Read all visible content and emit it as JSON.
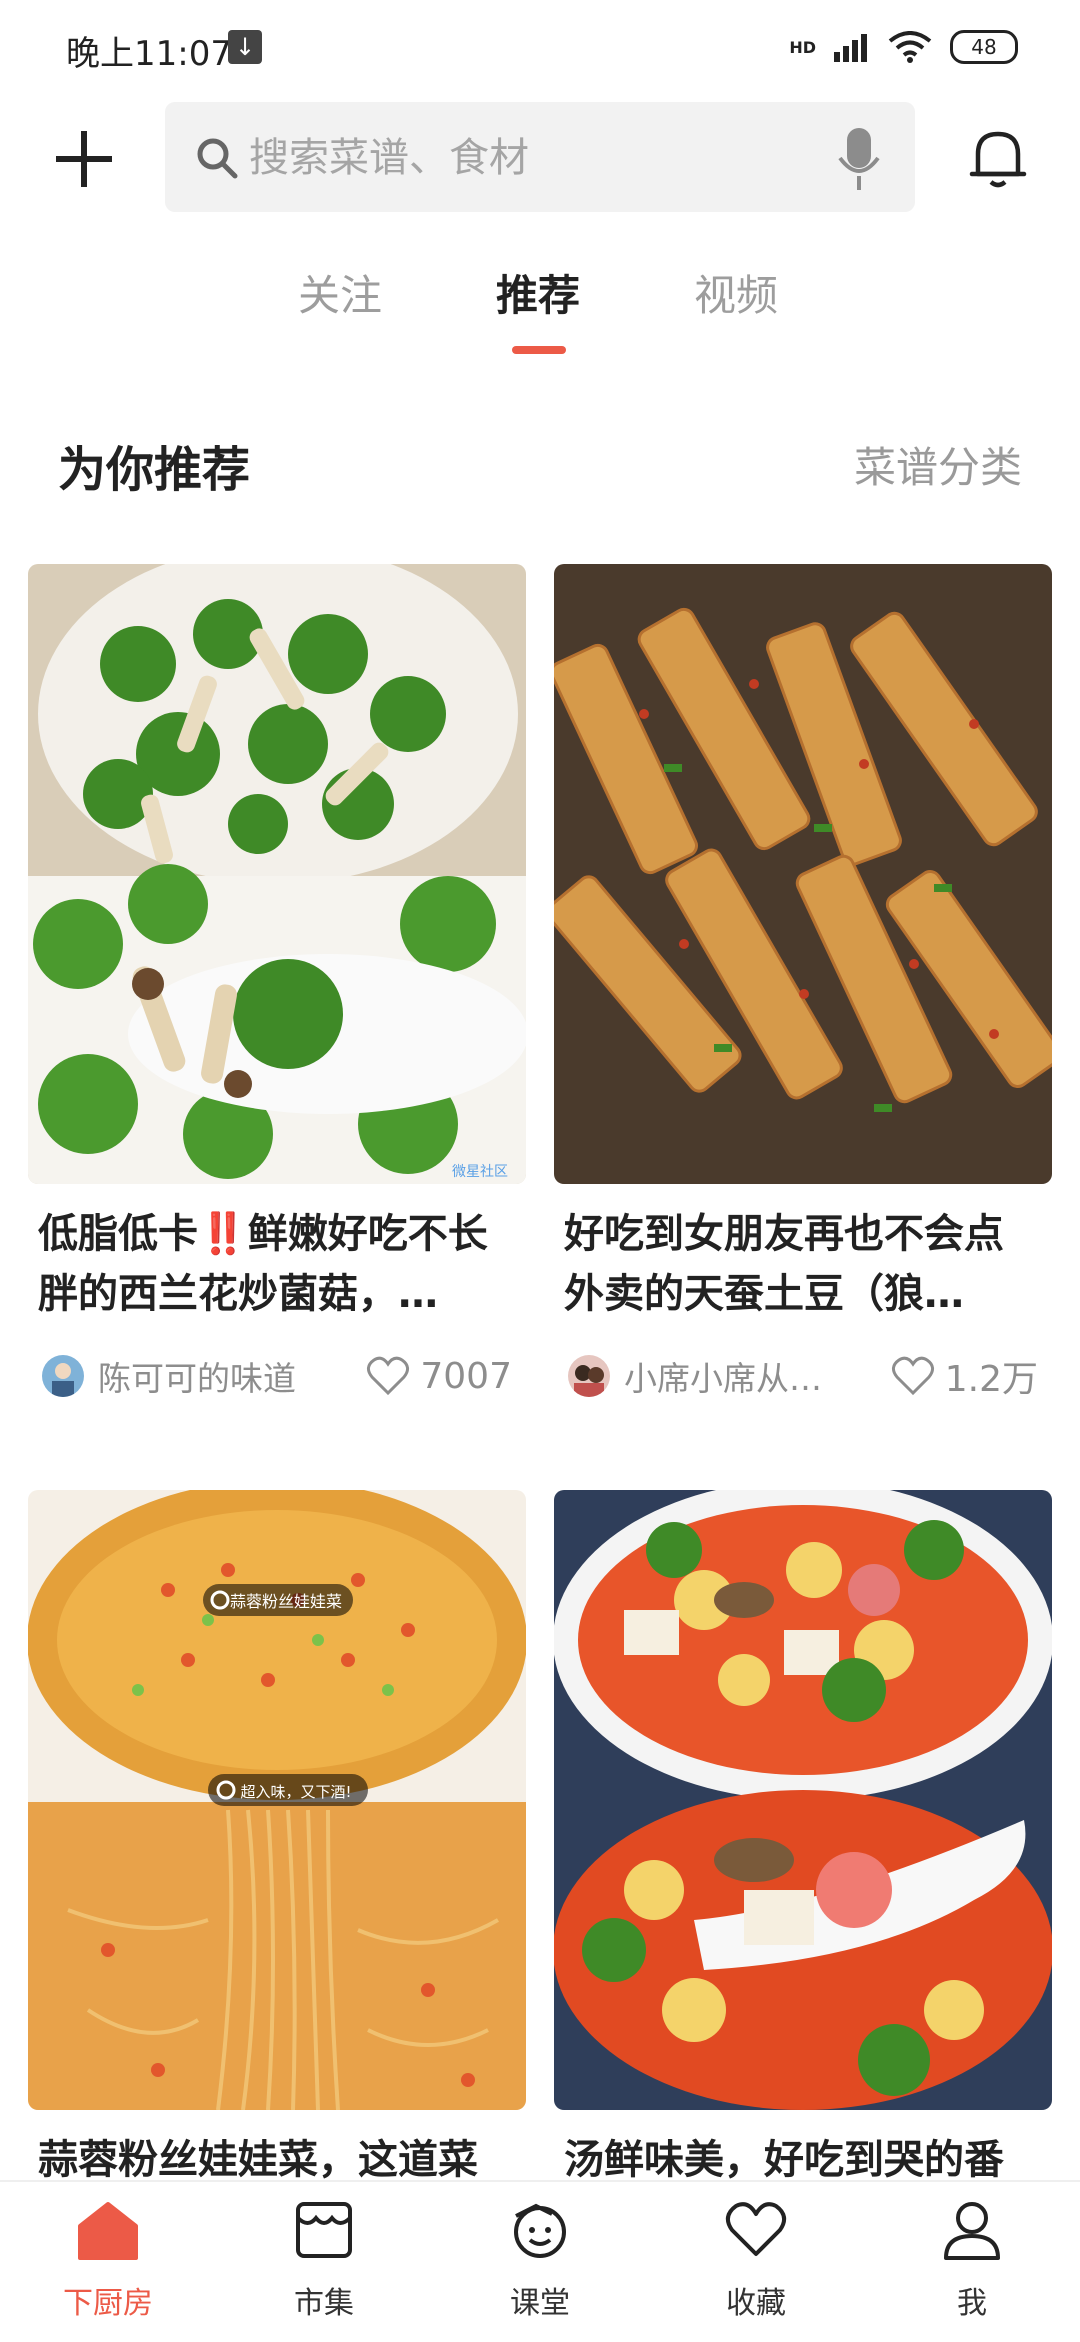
{
  "status": {
    "time": "晚上11:07",
    "network": "HD",
    "battery": "48"
  },
  "search": {
    "placeholder": "搜索菜谱、食材"
  },
  "tabs": [
    {
      "label": "关注"
    },
    {
      "label": "推荐",
      "active": true
    },
    {
      "label": "视频"
    }
  ],
  "section": {
    "title": "为你推荐",
    "link": "菜谱分类"
  },
  "cards": [
    {
      "title": "低脂低卡‼️鲜嫩好吃不长胖的西兰花炒菌菇，…",
      "author": "陈可可的味道",
      "likes": "7007"
    },
    {
      "title": "好吃到女朋友再也不会点外卖的天蚕土豆（狼…",
      "author": "小席小席从…",
      "likes": "1.2万"
    },
    {
      "title": "蒜蓉粉丝娃娃菜，这道菜",
      "author": "",
      "likes": "",
      "tags": [
        "蒜蓉粉丝娃娃菜",
        "超入味，又下酒!"
      ]
    },
    {
      "title": "汤鲜味美，好吃到哭的番",
      "author": "",
      "likes": ""
    }
  ],
  "watermark": "微星社区",
  "bottom_nav": [
    {
      "label": "下厨房",
      "icon": "home-icon",
      "active": true
    },
    {
      "label": "市集",
      "icon": "market-icon"
    },
    {
      "label": "课堂",
      "icon": "classroom-icon"
    },
    {
      "label": "收藏",
      "icon": "heart-icon"
    },
    {
      "label": "我",
      "icon": "profile-icon"
    }
  ],
  "colors": {
    "accent": "#ec5a47",
    "text": "#222222",
    "muted": "#9a9a9a",
    "search_bg": "#f2f2f2"
  }
}
